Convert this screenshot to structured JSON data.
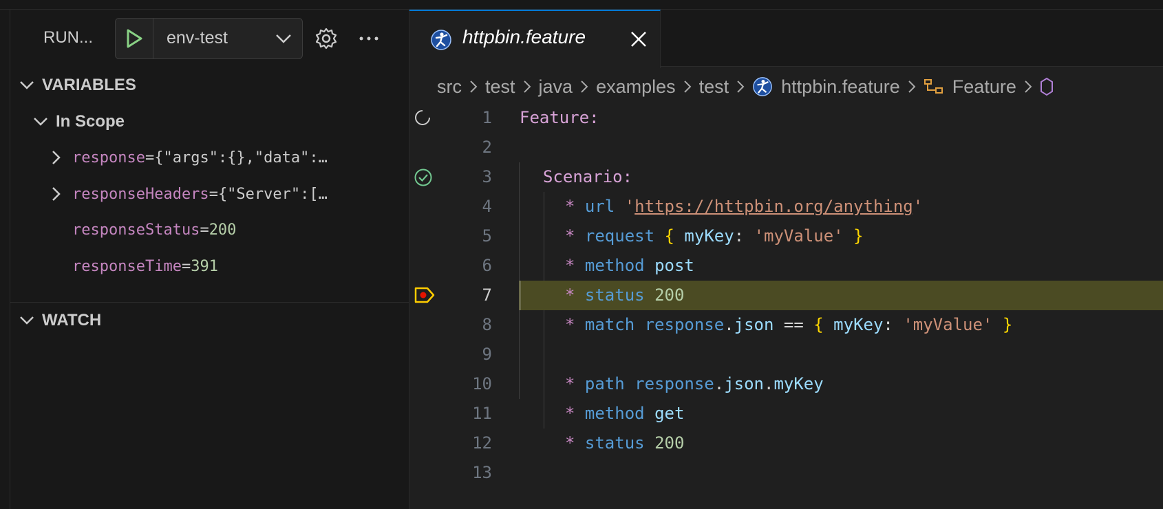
{
  "sidebar": {
    "run_title": "RUN...",
    "config_name": "env-test",
    "variables_label": "VARIABLES",
    "in_scope_label": "In Scope",
    "watch_label": "WATCH",
    "variables": [
      {
        "name": "response",
        "eq": " = ",
        "value": "{\"args\":{},\"data\":…",
        "kind": "object"
      },
      {
        "name": "responseHeaders",
        "eq": " = ",
        "value": "{\"Server\":[…",
        "kind": "object"
      },
      {
        "name": "responseStatus",
        "eq": " = ",
        "value": "200",
        "kind": "number"
      },
      {
        "name": "responseTime",
        "eq": " = ",
        "value": "391",
        "kind": "number"
      }
    ]
  },
  "editor": {
    "tab_label": "httpbin.feature",
    "breadcrumbs": [
      "src",
      "test",
      "java",
      "examples",
      "test",
      "httpbin.feature",
      "Feature"
    ],
    "line_numbers": [
      "1",
      "2",
      "3",
      "4",
      "5",
      "6",
      "7",
      "8",
      "9",
      "10",
      "11",
      "12",
      "13"
    ],
    "code": {
      "l1_feature": "Feature:",
      "l3_scenario": "Scenario:",
      "star": "*",
      "l4_kw": "url",
      "l4_q1": "'",
      "l4_url": "https://httpbin.org/anything",
      "l4_q2": "'",
      "l5_kw": "request",
      "l5_ob": "{",
      "l5_key": "myKey",
      "l5_colon": ":",
      "l5_val": "'myValue'",
      "l5_cb": "}",
      "l6_kw": "method",
      "l6_val": "post",
      "l7_kw": "status",
      "l7_val": "200",
      "l8_kw": "match",
      "l8_a": "response",
      "l8_dot": ".",
      "l8_b": "json",
      "l8_op": "==",
      "l8_ob": "{",
      "l8_key": "myKey",
      "l8_colon": ":",
      "l8_val": "'myValue'",
      "l8_cb": "}",
      "l10_kw": "path",
      "l10_a": "response",
      "l10_dot1": ".",
      "l10_b": "json",
      "l10_dot2": ".",
      "l10_c": "myKey",
      "l11_kw": "method",
      "l11_val": "get",
      "l12_kw": "status",
      "l12_val": "200"
    }
  },
  "colors": {
    "accent": "#0078d4",
    "highlight_line": "#4b4b23",
    "breakpoint": "#e51400",
    "debug_arrow": "#ffcc00",
    "passed": "#73c991",
    "play": "#89d185"
  }
}
